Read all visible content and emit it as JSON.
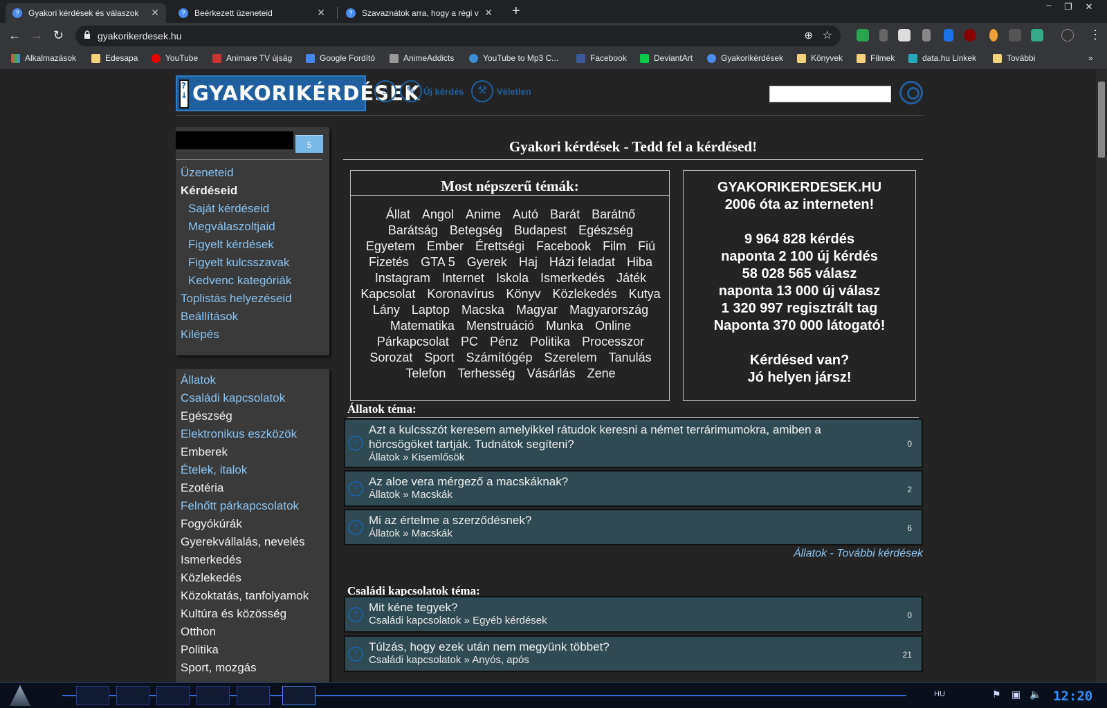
{
  "browser": {
    "tabs": [
      {
        "title": "Gyakori kérdések és válaszok",
        "active": true
      },
      {
        "title": "Beérkezett üzeneteid",
        "active": false
      },
      {
        "title": "Szavaznátok arra, hogy a régi va",
        "active": false
      }
    ],
    "url": "gyakorikerdesek.hu",
    "bookmarks": [
      "Alkalmazások",
      "Edesapa",
      "YouTube",
      "Animare TV újság",
      "Google Fordító",
      "AnimeAddicts",
      "YouTube to Mp3 C...",
      "Facebook",
      "DeviantArt",
      "Gyakorikérdések",
      "Könyvek",
      "Filmek",
      "data.hu Linkek",
      "További"
    ]
  },
  "header": {
    "logo": "GYAKORIKÉRDÉSEK",
    "new_question": "Új kérdés",
    "random": "Véletlen"
  },
  "user": {
    "badge": "5"
  },
  "menu": [
    "Üzeneteid",
    "Kérdéseid",
    "Saját kérdéseid",
    "Megválaszoltjaid",
    "Figyelt kérdések",
    "Figyelt kulcsszavak",
    "Kedvenc kategóriák",
    "Toplistás helyezéseid",
    "Beállítások",
    "Kilépés"
  ],
  "categories": [
    "Állatok",
    "Családi kapcsolatok",
    "Egészség",
    "Elektronikus eszközök",
    "Emberek",
    "Ételek, italok",
    "Ezotéria",
    "Felnőtt párkapcsolatok",
    "Fogyókúrák",
    "Gyerekvállalás, nevelés",
    "Ismerkedés",
    "Közlekedés",
    "Közoktatás, tanfolyamok",
    "Kultúra és közösség",
    "Otthon",
    "Politika",
    "Sport, mozgás"
  ],
  "main": {
    "title": "Gyakori kérdések - Tedd fel a kérdésed!",
    "popular_title": "Most népszerű témák:",
    "topics": [
      "Állat",
      "Angol",
      "Anime",
      "Autó",
      "Barát",
      "Barátnő",
      "Barátság",
      "Betegség",
      "Budapest",
      "Egészség",
      "Egyetem",
      "Ember",
      "Érettségi",
      "Facebook",
      "Film",
      "Fiú",
      "Fizetés",
      "GTA 5",
      "Gyerek",
      "Haj",
      "Házi feladat",
      "Hiba",
      "Instagram",
      "Internet",
      "Iskola",
      "Ismerkedés",
      "Játék",
      "Kapcsolat",
      "Koronavírus",
      "Könyv",
      "Közlekedés",
      "Kutya",
      "Lány",
      "Laptop",
      "Macska",
      "Magyar",
      "Magyarország",
      "Matematika",
      "Menstruáció",
      "Munka",
      "Online",
      "Párkapcsolat",
      "PC",
      "Pénz",
      "Politika",
      "Processzor",
      "Sorozat",
      "Sport",
      "Számítógép",
      "Szerelem",
      "Tanulás",
      "Telefon",
      "Terhesség",
      "Vásárlás",
      "Zene"
    ],
    "stats": [
      "GYAKORIKERDESEK.HU",
      "2006 óta az interneten!",
      "",
      "9 964 828 kérdés",
      "naponta 2 100 új kérdés",
      "58 028 565 válasz",
      "naponta 13 000 új válasz",
      "1 320 997 regisztrált tag",
      "Naponta 370 000 látogató!",
      "",
      "Kérdésed van?",
      "Jó helyen jársz!"
    ],
    "sections": [
      {
        "title": "Állatok téma:",
        "more": "Állatok - További kérdések",
        "questions": [
          {
            "text": "Azt a kulcsszót keresem amelyikkel rátudok keresni a német terrárimumokra, amiben a hörcsögöket tartják. Tudnátok segíteni?",
            "category": "Állatok » Kisemlősök",
            "answers": "0"
          },
          {
            "text": "Az aloe vera mérgező a macskáknak?",
            "category": "Állatok » Macskák",
            "answers": "2"
          },
          {
            "text": "Mi az értelme a szerződésnek?",
            "category": "Állatok » Macskák",
            "answers": "6"
          }
        ]
      },
      {
        "title": "Családi kapcsolatok téma:",
        "questions": [
          {
            "text": "Mit kéne tegyek?",
            "category": "Családi kapcsolatok » Egyéb kérdések",
            "answers": "0"
          },
          {
            "text": "Túlzás, hogy ezek után nem megyünk többet?",
            "category": "Családi kapcsolatok » Anyós, após",
            "answers": "21"
          }
        ]
      }
    ]
  },
  "taskbar": {
    "lang": "HU",
    "clock": "12:20"
  }
}
